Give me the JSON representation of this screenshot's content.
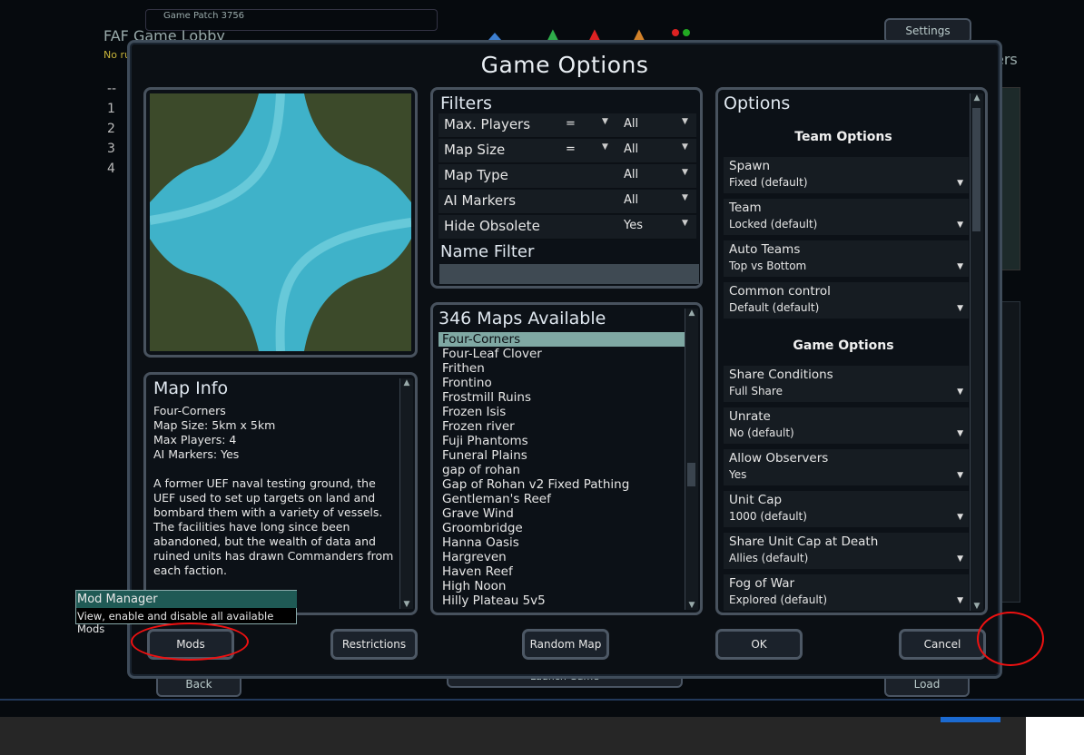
{
  "lobby": {
    "patch_label": "Game Patch 3756",
    "title": "FAF Game Lobby",
    "subtitle": "No ru",
    "right_label": "ers",
    "slot_header": "--",
    "slots": [
      "1",
      "2",
      "3",
      "4"
    ],
    "settings_label": "Settings",
    "back_label": "Back",
    "launch_label": "Launch Game",
    "load_label": "Load"
  },
  "dialog": {
    "title": "Game Options",
    "filters": {
      "heading": "Filters",
      "rows": [
        {
          "label": "Max. Players",
          "operator": "=",
          "value": "All"
        },
        {
          "label": "Map Size",
          "operator": "=",
          "value": "All"
        },
        {
          "label": "Map Type",
          "operator": "",
          "value": "All"
        },
        {
          "label": "AI Markers",
          "operator": "",
          "value": "All"
        },
        {
          "label": "Hide Obsolete",
          "operator": "",
          "value": "Yes"
        }
      ],
      "name_filter_heading": "Name Filter",
      "name_filter_value": ""
    },
    "map_list": {
      "heading": "346 Maps Available",
      "items": [
        "Four-Corners",
        "Four-Leaf Clover",
        "Frithen",
        "Frontino",
        "Frostmill Ruins",
        "Frozen Isis",
        "Frozen river",
        "Fuji Phantoms",
        "Funeral Plains",
        "gap of rohan",
        "Gap of Rohan v2 Fixed Pathing",
        "Gentleman's Reef",
        "Grave Wind",
        "Groombridge",
        "Hanna Oasis",
        "Hargreven",
        "Haven Reef",
        "High Noon",
        "Hilly Plateau 5v5"
      ],
      "selected": "Four-Corners"
    },
    "map_info": {
      "heading": "Map Info",
      "name": "Four-Corners",
      "size": "Map Size: 5km x 5km",
      "players": "Max Players: 4",
      "markers": "AI Markers: Yes",
      "description": "A former UEF naval testing ground, the UEF used to set up targets on land and bombard them with a variety of vessels. The facilities have long since been abandoned, but the wealth of data and ruined units has drawn Commanders from each faction."
    },
    "options": {
      "heading": "Options",
      "team_section": "Team Options",
      "team_items": [
        {
          "label": "Spawn",
          "value": "Fixed (default)"
        },
        {
          "label": "Team",
          "value": "Locked (default)"
        },
        {
          "label": "Auto Teams",
          "value": "Top vs Bottom"
        },
        {
          "label": "Common control",
          "value": "Default (default)"
        }
      ],
      "game_section": "Game Options",
      "game_items": [
        {
          "label": "Share Conditions",
          "value": "Full Share"
        },
        {
          "label": "Unrate",
          "value": "No (default)"
        },
        {
          "label": "Allow Observers",
          "value": "Yes"
        },
        {
          "label": "Unit Cap",
          "value": "1000 (default)"
        },
        {
          "label": "Share Unit Cap at Death",
          "value": "Allies (default)"
        },
        {
          "label": "Fog of War",
          "value": "Explored (default)"
        }
      ]
    },
    "buttons": {
      "mods": "Mods",
      "restrictions": "Restrictions",
      "random_map": "Random Map",
      "ok": "OK",
      "cancel": "Cancel"
    },
    "tooltip": {
      "title": "Mod Manager",
      "body": "View, enable and disable all available Mods"
    }
  },
  "colors": {
    "selected_row": "#7fa8a3",
    "tooltip_header": "#1f5a55",
    "annotation_circle": "#e11111",
    "water": "#3fb2c9",
    "land": "#3c4a2a"
  }
}
